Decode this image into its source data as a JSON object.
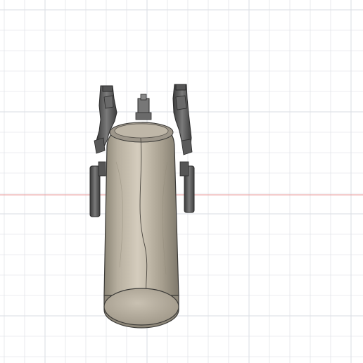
{
  "scene": {
    "type": "cad-3d-viewport",
    "view": "front",
    "grid_visible": true,
    "model": "camera-handle-mount"
  },
  "colors": {
    "background": "#ffffff",
    "grid_line": "#dadde3",
    "axis_x": "#e89a9a",
    "axis_y": "#9aa7e0",
    "body_fill": "#b9b1a2",
    "body_edge": "#3b3a37",
    "dark_part": "#4a4a4a",
    "grey_part": "#6f6f6f"
  }
}
